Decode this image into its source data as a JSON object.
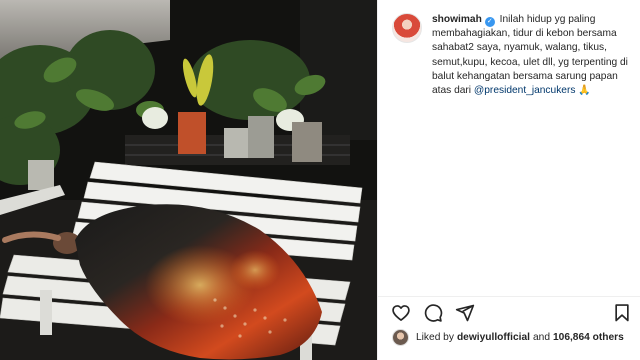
{
  "post": {
    "username": "showimah",
    "caption": "Inilah hidup yg paling membahagiakan, tidur di kebon bersama sahabat2 saya, nyamuk, walang, tikus, semut,kupu, kecoa, ulet dll, yg terpenting di balut kehangatan bersama sarung papan atas dari",
    "mention": "@president_jancukers",
    "emoji": "🙏"
  },
  "likes": {
    "prefix": "Liked by",
    "user": "dewiyullofficial",
    "conjunction": "and",
    "count": "106,864 others"
  },
  "icons": [
    "heart-icon",
    "comment-icon",
    "share-icon",
    "bookmark-icon",
    "verified-icon"
  ],
  "colors": {
    "verified": "#3897f0",
    "mention": "#00376b",
    "text": "#262626"
  }
}
